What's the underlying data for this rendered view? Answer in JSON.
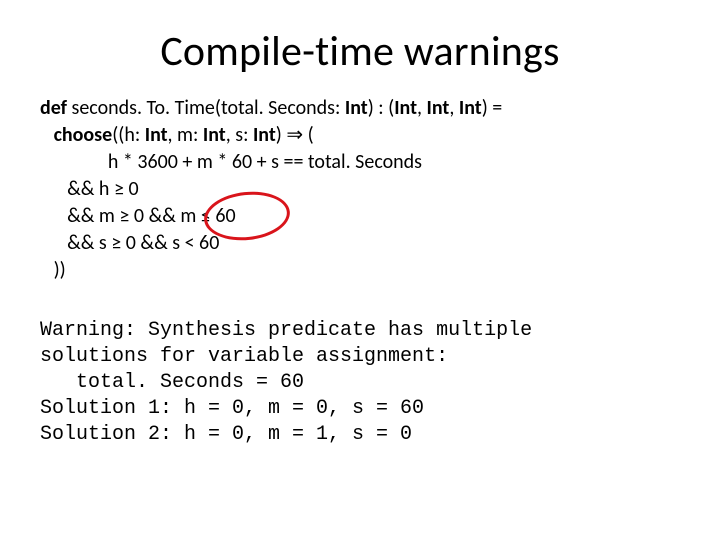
{
  "title": "Compile-time warnings",
  "code": {
    "l1a": "def",
    "l1b": " seconds. To. Time(total. Seconds: ",
    "l1c": "Int",
    "l1d": ") : (",
    "l1e": "Int",
    "l1f": ", ",
    "l1g": "Int",
    "l1h": ", ",
    "l1i": "Int",
    "l1j": ") =",
    "l2a": "   choose",
    "l2b": "((h: ",
    "l2c": "Int",
    "l2d": ", m: ",
    "l2e": "Int",
    "l2f": ", s: ",
    "l2g": "Int",
    "l2h": ") ⇒ (",
    "l3": "               h * 3600 + m * 60 + s == total. Seconds",
    "l4": "      && h ≥ 0",
    "l5": "      && m ≥ 0 && m ≤ 60",
    "l6": "      && s ≥ 0 && s < 60",
    "l7": "   ))"
  },
  "warn": {
    "l1": "Warning: Synthesis predicate has multiple",
    "l2": "solutions for variable assignment:",
    "l3": "   total. Seconds = 60",
    "l4": "Solution 1: h = 0, m = 0, s = 60",
    "l5": "Solution 2: h = 0, m = 1, s = 0"
  },
  "annotation": {
    "circle_target": "m ≤ 60"
  }
}
